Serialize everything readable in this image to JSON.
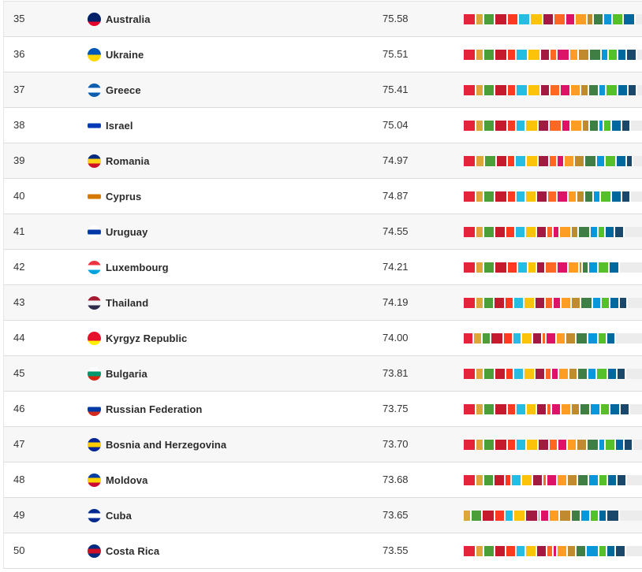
{
  "sdg_colors": [
    "#e5243b",
    "#dda63a",
    "#4c9f38",
    "#c5192d",
    "#ff3a21",
    "#26bde2",
    "#fcc30b",
    "#a21942",
    "#fd6925",
    "#dd1367",
    "#fd9d24",
    "#bf8b2e",
    "#3f7e44",
    "#0a97d9",
    "#56c02b",
    "#00689d",
    "#19486a"
  ],
  "rows": [
    {
      "rank": "35",
      "country": "Australia",
      "score": "75.58",
      "flag": [
        "#012169",
        "#012169",
        "#e4002b"
      ],
      "segments": [
        9,
        5,
        8,
        9,
        8,
        8,
        9,
        8,
        8,
        7,
        8,
        4,
        7,
        6,
        8,
        8
      ]
    },
    {
      "rank": "36",
      "country": "Ukraine",
      "score": "75.51",
      "flag": [
        "#0057b7",
        "#ffd700"
      ],
      "segments": [
        9,
        5,
        8,
        9,
        6,
        8,
        9,
        7,
        4,
        9,
        6,
        8,
        8,
        5,
        6,
        6,
        7
      ]
    },
    {
      "rank": "37",
      "country": "Greece",
      "score": "75.41",
      "flag": [
        "#0d5eaf",
        "#ffffff",
        "#0d5eaf"
      ],
      "segments": [
        9,
        5,
        8,
        9,
        6,
        8,
        9,
        7,
        7,
        7,
        7,
        5,
        7,
        5,
        8,
        7,
        6
      ]
    },
    {
      "rank": "38",
      "country": "Israel",
      "score": "75.04",
      "flag": [
        "#ffffff",
        "#0038b8",
        "#ffffff"
      ],
      "segments": [
        9,
        5,
        8,
        9,
        6,
        6,
        9,
        8,
        9,
        6,
        8,
        5,
        6,
        3,
        5,
        7,
        6
      ]
    },
    {
      "rank": "39",
      "country": "Romania",
      "score": "74.97",
      "flag": [
        "#002b7f",
        "#fcd116",
        "#ce1126"
      ],
      "segments": [
        9,
        6,
        8,
        8,
        5,
        8,
        8,
        8,
        5,
        5,
        7,
        7,
        8,
        6,
        8,
        7,
        4
      ]
    },
    {
      "rank": "40",
      "country": "Cyprus",
      "score": "74.87",
      "flag": [
        "#ffffff",
        "#d57800",
        "#ffffff"
      ],
      "segments": [
        9,
        5,
        8,
        9,
        6,
        6,
        8,
        8,
        6,
        8,
        6,
        5,
        6,
        4,
        8,
        7,
        6
      ]
    },
    {
      "rank": "41",
      "country": "Uruguay",
      "score": "74.55",
      "flag": [
        "#ffffff",
        "#0038a8",
        "#ffffff"
      ],
      "segments": [
        9,
        5,
        8,
        8,
        6,
        7,
        8,
        7,
        4,
        4,
        8,
        5,
        8,
        5,
        5,
        6,
        7
      ]
    },
    {
      "rank": "42",
      "country": "Luxembourg",
      "score": "74.21",
      "flag": [
        "#ef3340",
        "#ffffff",
        "#00a3e0"
      ],
      "segments": [
        9,
        5,
        8,
        9,
        7,
        7,
        6,
        6,
        8,
        8,
        8,
        1,
        4,
        6,
        8,
        7
      ]
    },
    {
      "rank": "43",
      "country": "Thailand",
      "score": "74.19",
      "flag": [
        "#a51931",
        "#f4f5f8",
        "#2d2a4a"
      ],
      "segments": [
        9,
        5,
        7,
        8,
        6,
        7,
        8,
        7,
        5,
        5,
        7,
        7,
        8,
        6,
        6,
        6,
        5
      ]
    },
    {
      "rank": "44",
      "country": "Kyrgyz Republic",
      "score": "74.00",
      "flag": [
        "#e8112d",
        "#e8112d",
        "#ffef00"
      ],
      "segments": [
        7,
        6,
        6,
        9,
        6,
        6,
        8,
        6,
        2,
        7,
        7,
        7,
        8,
        7,
        6,
        6
      ]
    },
    {
      "rank": "45",
      "country": "Bulgaria",
      "score": "73.81",
      "flag": [
        "#ffffff",
        "#00966e",
        "#d62612"
      ],
      "segments": [
        9,
        5,
        8,
        8,
        5,
        7,
        8,
        7,
        4,
        4,
        7,
        6,
        7,
        6,
        8,
        6,
        6
      ]
    },
    {
      "rank": "46",
      "country": "Russian Federation",
      "score": "73.75",
      "flag": [
        "#ffffff",
        "#0039a6",
        "#d52b1e"
      ],
      "segments": [
        9,
        5,
        8,
        9,
        6,
        7,
        7,
        7,
        3,
        6,
        7,
        6,
        7,
        7,
        7,
        7,
        6
      ]
    },
    {
      "rank": "47",
      "country": "Bosnia and Herzegovina",
      "score": "73.70",
      "flag": [
        "#002395",
        "#fecb00",
        "#002395"
      ],
      "segments": [
        9,
        5,
        8,
        9,
        6,
        7,
        8,
        8,
        6,
        6,
        7,
        7,
        8,
        4,
        7,
        6,
        6
      ]
    },
    {
      "rank": "48",
      "country": "Moldova",
      "score": "73.68",
      "flag": [
        "#003da5",
        "#ffd200",
        "#cc092f"
      ],
      "segments": [
        9,
        5,
        7,
        8,
        4,
        7,
        8,
        7,
        2,
        7,
        7,
        7,
        8,
        7,
        6,
        6,
        7
      ]
    },
    {
      "rank": "49",
      "country": "Cuba",
      "score": "73.65",
      "flag": [
        "#002a8f",
        "#ffffff",
        "#002a8f"
      ],
      "segments": [
        0,
        5,
        8,
        9,
        7,
        6,
        8,
        9,
        1,
        6,
        7,
        8,
        7,
        6,
        6,
        5,
        9
      ]
    },
    {
      "rank": "50",
      "country": "Costa Rica",
      "score": "73.55",
      "flag": [
        "#002b7f",
        "#ce1126",
        "#002b7f"
      ],
      "segments": [
        9,
        5,
        8,
        8,
        7,
        6,
        8,
        7,
        4,
        2,
        7,
        6,
        7,
        9,
        5,
        6,
        7
      ]
    }
  ]
}
